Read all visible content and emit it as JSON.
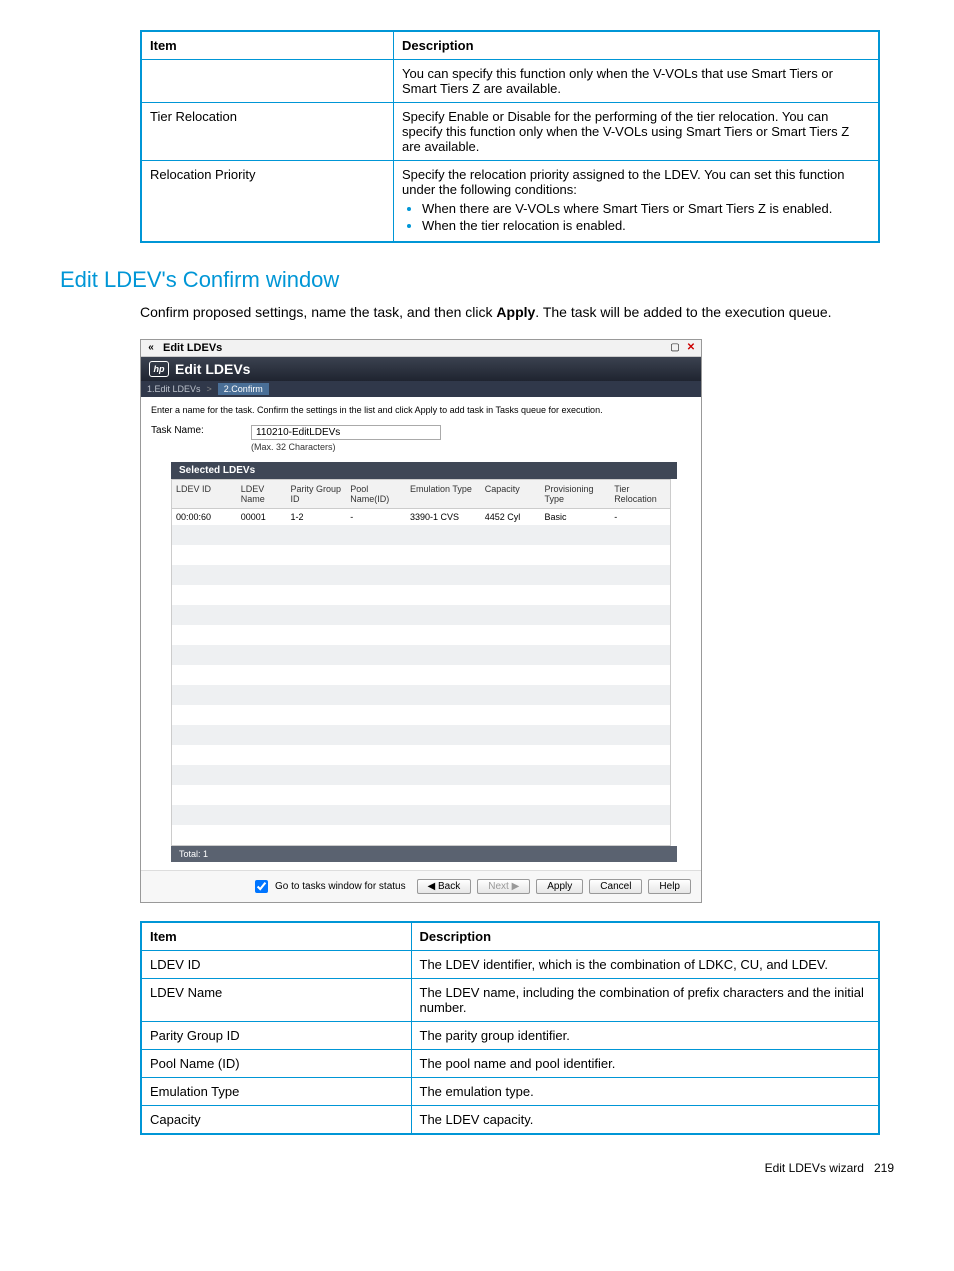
{
  "top_table": {
    "headers": [
      "Item",
      "Description"
    ],
    "rows": [
      {
        "item": "",
        "desc": "You can specify this function only when the V-VOLs that use Smart Tiers or Smart Tiers Z are available."
      },
      {
        "item": "Tier Relocation",
        "desc": "Specify Enable or Disable for the performing of the tier relocation. You can specify this function only when the V-VOLs using Smart Tiers or Smart Tiers Z are available."
      },
      {
        "item": "Relocation Priority",
        "desc_intro": "Specify the relocation priority assigned to the LDEV. You can set this function under the following conditions:",
        "bullets": [
          "When there are V-VOLs where Smart Tiers or Smart Tiers Z is enabled.",
          "When the tier relocation is enabled."
        ]
      }
    ]
  },
  "section_heading": "Edit LDEV's Confirm window",
  "section_body_pre": "Confirm proposed settings, name the task, and then click ",
  "section_body_bold": "Apply",
  "section_body_post": ". The task will be added to the execution queue.",
  "wizard": {
    "titlebar_text": "Edit LDEVs",
    "collapse_icon": "«",
    "window_icon": "▢",
    "close_icon": "✕",
    "header_text": "Edit LDEVs",
    "logo_text": "hp",
    "crumb1": "1.Edit LDEVs",
    "crumb_sep": ">",
    "crumb2": "2.Confirm",
    "instruction": "Enter a name for the task. Confirm the settings in the list and click Apply to add task in Tasks queue for execution.",
    "task_label": "Task Name:",
    "task_value": "110210-EditLDEVs",
    "task_hint": "(Max. 32 Characters)",
    "selected_header": "Selected LDEVs",
    "cols": [
      "LDEV ID",
      "LDEV Name",
      "Parity Group ID",
      "Pool Name(ID)",
      "Emulation Type",
      "Capacity",
      "Provisioning Type",
      "Tier Relocation"
    ],
    "row": [
      "00:00:60",
      "00001",
      "1-2",
      "-",
      "3390-1 CVS",
      "4452 Cyl",
      "Basic",
      "-"
    ],
    "total_label": "Total: 1",
    "go_tasks_label": "Go to tasks window for status",
    "btn_back": "◀ Back",
    "btn_next": "Next ▶",
    "btn_apply": "Apply",
    "btn_cancel": "Cancel",
    "btn_help": "Help"
  },
  "bottom_table": {
    "headers": [
      "Item",
      "Description"
    ],
    "rows": [
      {
        "item": "LDEV ID",
        "desc": "The LDEV identifier, which is the combination of LDKC, CU, and LDEV."
      },
      {
        "item": "LDEV Name",
        "desc": "The LDEV name, including the combination of prefix characters and the initial number."
      },
      {
        "item": "Parity Group ID",
        "desc": "The parity group identifier."
      },
      {
        "item": "Pool Name (ID)",
        "desc": "The pool name and pool identifier."
      },
      {
        "item": "Emulation Type",
        "desc": "The emulation type."
      },
      {
        "item": "Capacity",
        "desc": "The LDEV capacity."
      }
    ]
  },
  "footer_text": "Edit LDEVs wizard",
  "footer_page": "219"
}
